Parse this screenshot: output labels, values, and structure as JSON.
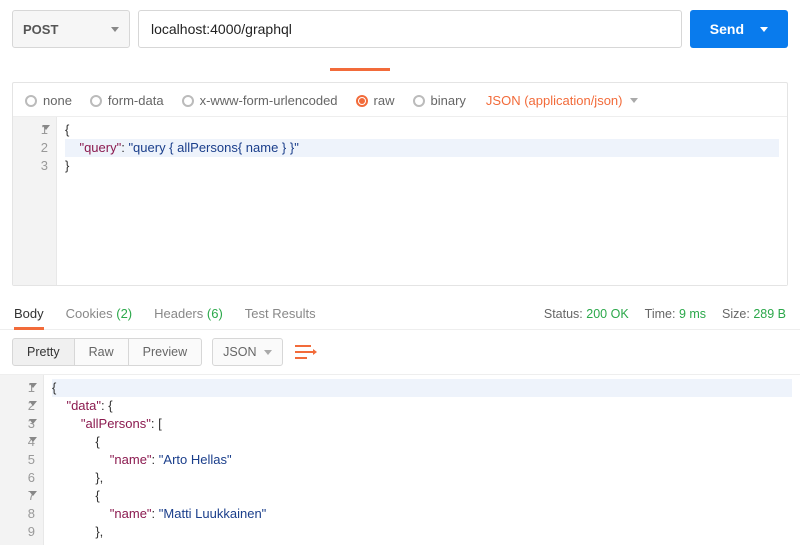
{
  "request": {
    "method": "POST",
    "url": "localhost:4000/graphql",
    "send_label": "Send"
  },
  "body_types": {
    "none": "none",
    "form_data": "form-data",
    "urlencoded": "x-www-form-urlencoded",
    "raw": "raw",
    "binary": "binary",
    "content_type": "JSON (application/json)"
  },
  "request_body": {
    "line1": "{",
    "line2_key": "\"query\"",
    "line2_val": "\"query { allPersons{ name } }\"",
    "line3": "}"
  },
  "response_tabs": {
    "body": "Body",
    "cookies": "Cookies",
    "cookies_count": "(2)",
    "headers": "Headers",
    "headers_count": "(6)",
    "tests": "Test Results"
  },
  "response_meta": {
    "status_label": "Status:",
    "status_value": "200 OK",
    "time_label": "Time:",
    "time_value": "9 ms",
    "size_label": "Size:",
    "size_value": "289 B"
  },
  "format": {
    "pretty": "Pretty",
    "raw": "Raw",
    "preview": "Preview",
    "json": "JSON"
  },
  "response_body": {
    "l1": "{",
    "l2_key": "\"data\"",
    "l3_key": "\"allPersons\"",
    "l4": "{",
    "l5_key": "\"name\"",
    "l5_val": "\"Arto Hellas\"",
    "l6": "},",
    "l7": "{",
    "l8_key": "\"name\"",
    "l8_val": "\"Matti Luukkainen\"",
    "l9": "},"
  }
}
